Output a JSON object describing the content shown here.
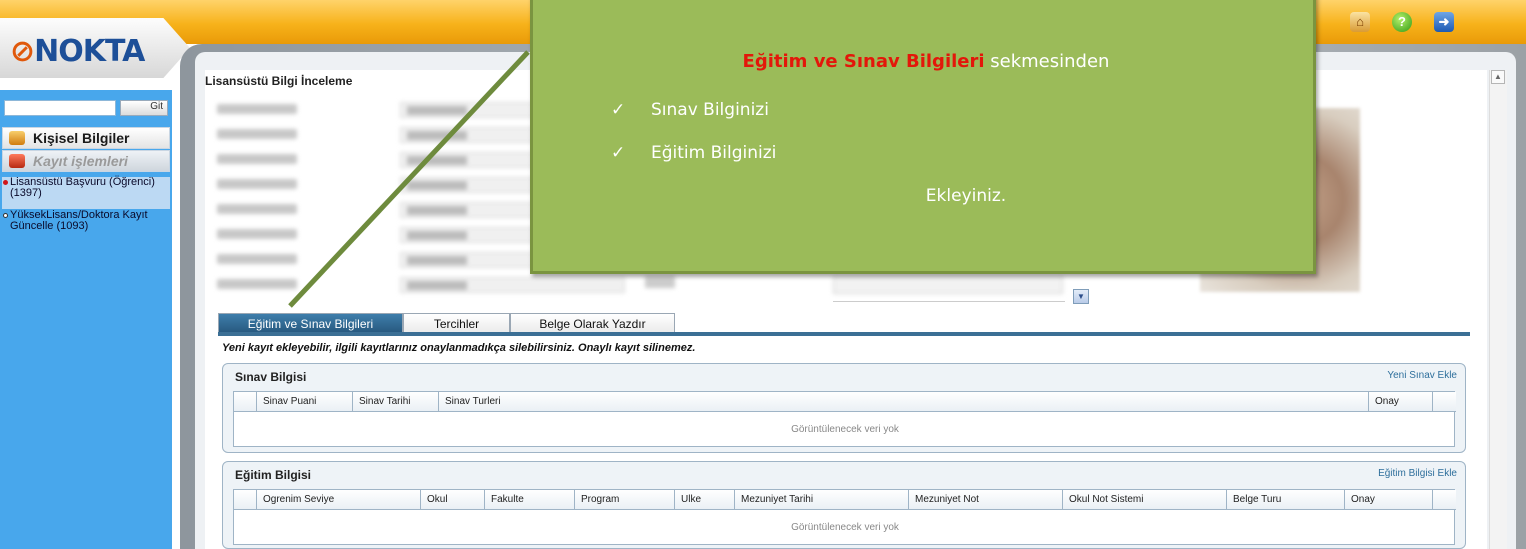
{
  "app": {
    "logo_text": "NOKTA"
  },
  "topbar": {
    "icons": [
      "home-icon",
      "help-icon",
      "exit-icon"
    ]
  },
  "sidebar": {
    "search_placeholder": "",
    "go_label": "Git",
    "personal_label": "Kişisel Bilgiler",
    "registration_label": "Kayıt işlemleri",
    "items": [
      {
        "label": "Lisansüstü Başvuru (Öğrenci) (1397)",
        "bullet": "filled"
      },
      {
        "label": "YüksekLisans/Doktora Kayıt Güncelle (1093)",
        "bullet": "empty"
      }
    ]
  },
  "page": {
    "title": "Lisansüstü Bilgi İnceleme"
  },
  "tabs": [
    {
      "label": "Eğitim ve Sınav Bilgileri",
      "active": true
    },
    {
      "label": "Tercihler",
      "active": false
    },
    {
      "label": "Belge Olarak Yazdır",
      "active": false
    }
  ],
  "notice": "Yeni kayıt ekleyebilir, ilgili kayıtlarınız onaylanmadıkça silebilirsiniz. Onaylı kayıt silinemez.",
  "exam_section": {
    "title": "Sınav Bilgisi",
    "add_link": "Yeni Sınav Ekle",
    "columns": [
      "Sinav Puani",
      "Sinav Tarihi",
      "Sinav Turleri",
      "Onay"
    ],
    "empty_text": "Görüntülenecek veri yok"
  },
  "education_section": {
    "title": "Eğitim Bilgisi",
    "add_link": "Eğitim Bilgisi Ekle",
    "columns": [
      "Ogrenim Seviye",
      "Okul",
      "Fakulte",
      "Program",
      "Ulke",
      "Mezuniyet Tarihi",
      "Mezuniyet Not",
      "Okul Not Sistemi",
      "Belge Turu",
      "Onay"
    ],
    "empty_text": "Görüntülenecek veri yok"
  },
  "callout": {
    "highlight": "Eğitim ve Sınav Bilgileri",
    "heading_rest": " sekmesinden",
    "bullets": [
      "Sınav Bilginizi",
      "Eğitim Bilginizi"
    ],
    "check_glyph": "✓",
    "closing": "Ekleyiniz."
  },
  "colors": {
    "topbar": "#f7b21a",
    "sidebar": "#48a7ec",
    "callout": "#9bbb59",
    "callout_highlight": "#e3170a",
    "active_tab": "#27587e"
  }
}
